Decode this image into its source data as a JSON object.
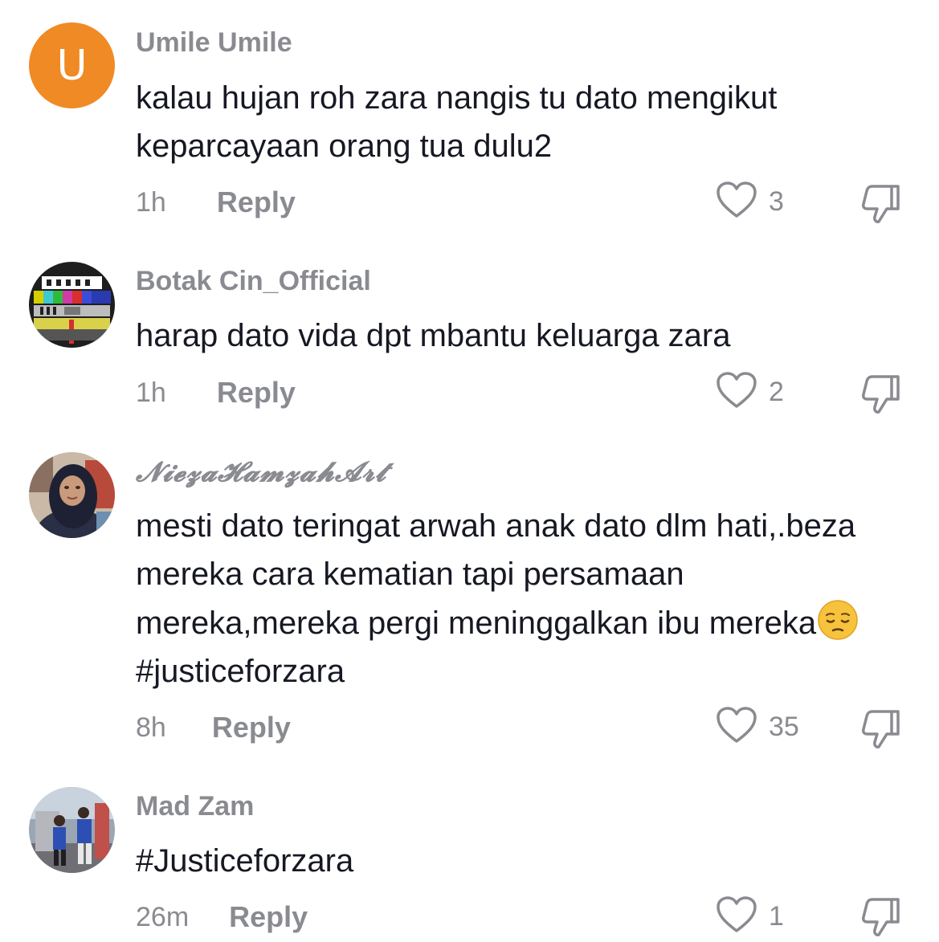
{
  "comments": [
    {
      "username": "Umile Umile",
      "avatar_letter": "U",
      "text": "kalau hujan roh zara nangis tu dato mengikut keparcayaan orang tua dulu2",
      "time": "1h",
      "reply_label": "Reply",
      "likes": "3"
    },
    {
      "username": "Botak Cin_Official",
      "text": "harap dato vida dpt mbantu keluarga zara",
      "time": "1h",
      "reply_label": "Reply",
      "likes": "2"
    },
    {
      "username": "𝓝𝓲𝓮𝔃𝓪𝓗𝓪𝓶𝔃𝓪𝓱𝓐𝓻𝓽",
      "text_before_emoji": "mesti dato teringat arwah anak dato dlm hati,.beza mereka cara kematian tapi persamaan mereka,mereka pergi meninggalkan ibu mereka",
      "text_after_emoji": "#justiceforzara",
      "emoji": "pensive-face",
      "time": "8h",
      "reply_label": "Reply",
      "likes": "35"
    },
    {
      "username": "Mad Zam",
      "text": "#Justiceforzara",
      "time": "26m",
      "reply_label": "Reply",
      "likes": "1"
    }
  ],
  "colors": {
    "avatar_orange": "#f08a24",
    "secondary_text": "#8a8b91",
    "primary_text": "#161823"
  }
}
